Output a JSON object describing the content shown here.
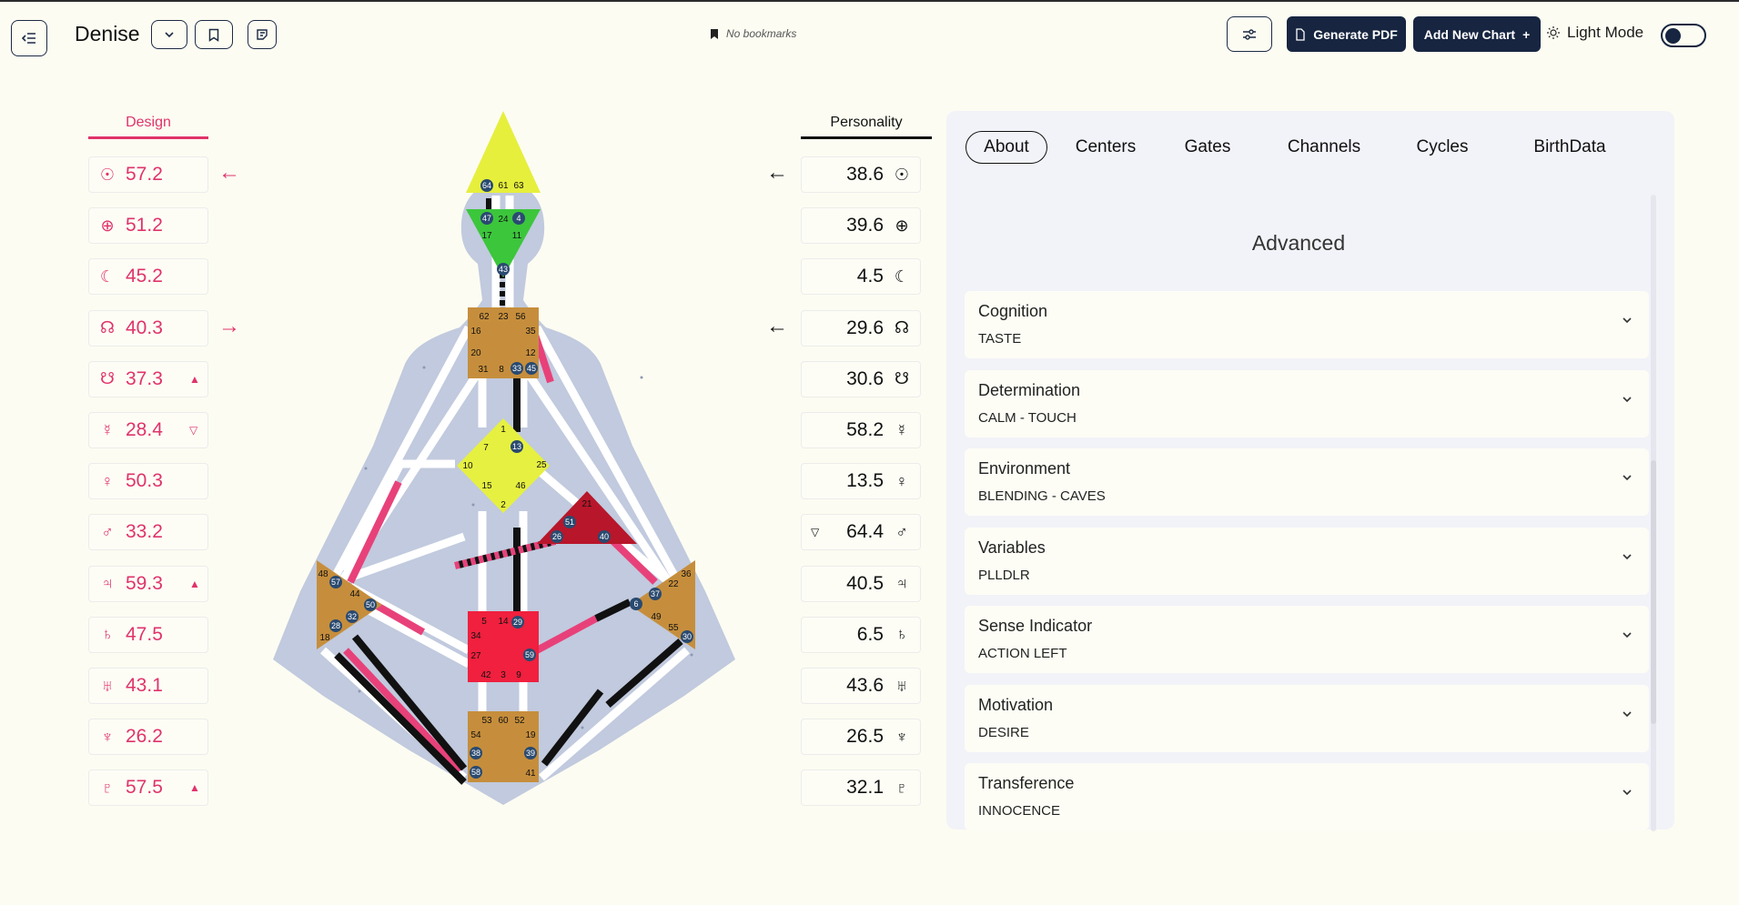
{
  "header": {
    "chart_name": "Denise",
    "bookmarks_text": "No bookmarks",
    "generate_pdf_label": "Generate PDF",
    "add_chart_label": "Add New Chart",
    "add_chart_plus": "+",
    "light_mode_label": "Light Mode",
    "light_mode_on": false
  },
  "design": {
    "header": "Design",
    "rows": [
      {
        "planet": "sun",
        "symbol": "☉",
        "value": "57.2",
        "marker": "",
        "arrow": "←"
      },
      {
        "planet": "earth",
        "symbol": "⊕",
        "value": "51.2",
        "marker": "",
        "arrow": ""
      },
      {
        "planet": "moon",
        "symbol": "☾",
        "value": "45.2",
        "marker": "",
        "arrow": ""
      },
      {
        "planet": "north-node",
        "symbol": "☊",
        "value": "40.3",
        "marker": "",
        "arrow": "→"
      },
      {
        "planet": "south-node",
        "symbol": "☋",
        "value": "37.3",
        "marker": "▲",
        "arrow": ""
      },
      {
        "planet": "mercury",
        "symbol": "☿",
        "value": "28.4",
        "marker": "▽",
        "arrow": ""
      },
      {
        "planet": "venus",
        "symbol": "♀",
        "value": "50.3",
        "marker": "",
        "arrow": ""
      },
      {
        "planet": "mars",
        "symbol": "♂",
        "value": "33.2",
        "marker": "",
        "arrow": ""
      },
      {
        "planet": "jupiter",
        "symbol": "♃",
        "value": "59.3",
        "marker": "▲",
        "arrow": ""
      },
      {
        "planet": "saturn",
        "symbol": "♄",
        "value": "47.5",
        "marker": "",
        "arrow": ""
      },
      {
        "planet": "uranus",
        "symbol": "♅",
        "value": "43.1",
        "marker": "",
        "arrow": ""
      },
      {
        "planet": "neptune",
        "symbol": "♆",
        "value": "26.2",
        "marker": "",
        "arrow": ""
      },
      {
        "planet": "pluto",
        "symbol": "♇",
        "value": "57.5",
        "marker": "▲",
        "arrow": ""
      }
    ]
  },
  "personality": {
    "header": "Personality",
    "rows": [
      {
        "planet": "sun",
        "symbol": "☉",
        "value": "38.6",
        "marker": "",
        "arrow": "←"
      },
      {
        "planet": "earth",
        "symbol": "⊕",
        "value": "39.6",
        "marker": "",
        "arrow": ""
      },
      {
        "planet": "moon",
        "symbol": "☾",
        "value": "4.5",
        "marker": "",
        "arrow": ""
      },
      {
        "planet": "north-node",
        "symbol": "☊",
        "value": "29.6",
        "marker": "",
        "arrow": "←"
      },
      {
        "planet": "south-node",
        "symbol": "☋",
        "value": "30.6",
        "marker": "",
        "arrow": ""
      },
      {
        "planet": "mercury",
        "symbol": "☿",
        "value": "58.2",
        "marker": "",
        "arrow": ""
      },
      {
        "planet": "venus",
        "symbol": "♀",
        "value": "13.5",
        "marker": "",
        "arrow": ""
      },
      {
        "planet": "mars",
        "symbol": "♂",
        "value": "64.4",
        "marker": "▽",
        "arrow": ""
      },
      {
        "planet": "jupiter",
        "symbol": "♃",
        "value": "40.5",
        "marker": "",
        "arrow": ""
      },
      {
        "planet": "saturn",
        "symbol": "♄",
        "value": "6.5",
        "marker": "",
        "arrow": ""
      },
      {
        "planet": "uranus",
        "symbol": "♅",
        "value": "43.6",
        "marker": "",
        "arrow": ""
      },
      {
        "planet": "neptune",
        "symbol": "♆",
        "value": "26.5",
        "marker": "",
        "arrow": ""
      },
      {
        "planet": "pluto",
        "symbol": "♇",
        "value": "32.1",
        "marker": "",
        "arrow": ""
      }
    ]
  },
  "bodygraph": {
    "head_gates": [
      "64",
      "61",
      "63"
    ],
    "ajna_gates": [
      "47",
      "24",
      "4",
      "17",
      "11",
      "43"
    ],
    "throat_gates": [
      "62",
      "23",
      "56",
      "16",
      "35",
      "20",
      "12",
      "31",
      "8",
      "33",
      "45"
    ],
    "g_gates": [
      "1",
      "7",
      "13",
      "10",
      "25",
      "15",
      "46",
      "2"
    ],
    "heart_gates": [
      "21",
      "51",
      "26",
      "40"
    ],
    "spleen_gates": [
      "48",
      "57",
      "44",
      "50",
      "32",
      "28",
      "18"
    ],
    "sacral_gates": [
      "5",
      "14",
      "29",
      "34",
      "27",
      "59",
      "42",
      "3",
      "9"
    ],
    "solar_plexus_gates": [
      "36",
      "22",
      "37",
      "6",
      "49",
      "55",
      "30"
    ],
    "root_gates": [
      "53",
      "60",
      "52",
      "54",
      "19",
      "38",
      "39",
      "58",
      "41"
    ],
    "colors": {
      "silhouette": "#c1cade",
      "channel_white": "#ffffff",
      "design_red": "#e8417a",
      "personality_black": "#111111",
      "head": "#e6ef3c",
      "ajna": "#3cc63c",
      "throat_g_root": "#c68e3c",
      "g": "#e6f040",
      "heart": "#b8162a",
      "sacral": "#f0203e",
      "active_gate": "#2a4a70"
    }
  },
  "tabs": [
    {
      "label": "About",
      "active": true
    },
    {
      "label": "Centers",
      "active": false
    },
    {
      "label": "Gates",
      "active": false
    },
    {
      "label": "Channels",
      "active": false
    },
    {
      "label": "Cycles",
      "active": false
    },
    {
      "label": "BirthData",
      "active": false
    }
  ],
  "panel": {
    "title": "Advanced",
    "cards": [
      {
        "title": "Cognition",
        "value": "TASTE"
      },
      {
        "title": "Determination",
        "value": "CALM - TOUCH"
      },
      {
        "title": "Environment",
        "value": "BLENDING - CAVES"
      },
      {
        "title": "Variables",
        "value": "PLLDLR"
      },
      {
        "title": "Sense Indicator",
        "value": "ACTION LEFT"
      },
      {
        "title": "Motivation",
        "value": "DESIRE"
      },
      {
        "title": "Transference",
        "value": "INNOCENCE"
      }
    ]
  }
}
